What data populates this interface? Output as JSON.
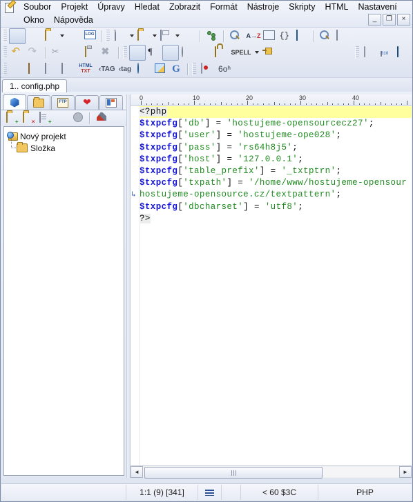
{
  "window": {
    "app_icon": "notepad-pencil-icon",
    "controls": {
      "minimize": "_",
      "restore": "❐",
      "close": "×"
    }
  },
  "menu": {
    "row1": [
      "Soubor",
      "Projekt",
      "Úpravy",
      "Hledat",
      "Zobrazit",
      "Formát",
      "Nástroje",
      "Skripty",
      "HTML",
      "Nastavení"
    ],
    "row2": [
      "Okno",
      "Nápověda"
    ]
  },
  "toolbars": {
    "row1": [
      {
        "name": "project-cube-icon",
        "glyph": "cube",
        "selected": true
      },
      {
        "name": "project-open-icon",
        "glyph": "cube-pages"
      },
      {
        "name": "project-folder-open-icon",
        "glyph": "folder-open"
      },
      {
        "name": "project-dropdown-arrow",
        "glyph": "arrow"
      },
      {
        "name": "project-save-icon",
        "glyph": "gray-blob"
      },
      {
        "name": "log-icon",
        "glyph": "log"
      },
      {
        "name": "new-file-icon",
        "glyph": "page"
      },
      {
        "name": "new-file-dropdown-arrow",
        "glyph": "arrow"
      },
      {
        "name": "open-file-icon",
        "glyph": "folder-open"
      },
      {
        "name": "open-file-dropdown-arrow",
        "glyph": "arrow"
      },
      {
        "name": "save-file-icon",
        "glyph": "disk"
      },
      {
        "name": "save-dropdown-arrow",
        "glyph": "arrow"
      },
      {
        "name": "close-file-icon",
        "glyph": "gray-blob"
      },
      {
        "name": "code-explorer-icon",
        "glyph": "tree-dots"
      },
      {
        "name": "find-icon",
        "glyph": "magnifier"
      },
      {
        "name": "replace-icon",
        "glyph": "a-to-z"
      },
      {
        "name": "find-in-files-icon",
        "glyph": "magnifier-screen"
      },
      {
        "name": "goto-icon",
        "glyph": "braces"
      },
      {
        "name": "dictionary-icon",
        "glyph": "book"
      },
      {
        "name": "print-preview-icon",
        "glyph": "preview"
      },
      {
        "name": "print-icon",
        "glyph": "printer"
      }
    ],
    "row2": [
      {
        "name": "undo-icon",
        "glyph": "undo"
      },
      {
        "name": "redo-icon",
        "glyph": "redo"
      },
      {
        "name": "cut-icon",
        "glyph": "scissors"
      },
      {
        "name": "copy-icon",
        "glyph": "copy"
      },
      {
        "name": "paste-icon",
        "glyph": "clipboard"
      },
      {
        "name": "delete-icon",
        "glyph": "x"
      },
      {
        "name": "format-text-icon",
        "glyph": "lines-blue",
        "selected": true
      },
      {
        "name": "pilcrow-icon",
        "glyph": "pilcrow"
      },
      {
        "name": "highlighter-icon",
        "glyph": "lines-red",
        "selected": true
      },
      {
        "name": "color-palette-icon",
        "glyph": "palette"
      },
      {
        "name": "numbered-list-icon",
        "glyph": "list"
      },
      {
        "name": "lock-icon",
        "glyph": "lock"
      },
      {
        "name": "spell-check-label",
        "glyph": "spell",
        "label": "SPELL"
      },
      {
        "name": "spell-dropdown-arrow",
        "glyph": "arrow"
      },
      {
        "name": "bookmark-pin-icon",
        "glyph": "pin"
      },
      {
        "name": "panel-toggle-icon",
        "glyph": "gray-square"
      },
      {
        "name": "hex-editor-icon",
        "glyph": "doc010"
      },
      {
        "name": "preview-monitor-icon",
        "glyph": "monitor"
      }
    ],
    "row3": [
      {
        "name": "indent-icon",
        "glyph": "indent"
      },
      {
        "name": "package-icon",
        "glyph": "box3d"
      },
      {
        "name": "color-table-icon",
        "glyph": "grid-color"
      },
      {
        "name": "table-10-icon",
        "glyph": "grid-10"
      },
      {
        "name": "html-to-txt-icon",
        "glyph": "html-txt"
      },
      {
        "name": "tag-upper-icon",
        "glyph": "tag",
        "label": "‹TAG"
      },
      {
        "name": "tag-lower-icon",
        "glyph": "tag",
        "label": "‹tag"
      },
      {
        "name": "browser-preview-icon",
        "glyph": "globe"
      },
      {
        "name": "flag-icon",
        "glyph": "flag"
      },
      {
        "name": "google-icon",
        "glyph": "g",
        "label": "G"
      },
      {
        "name": "record-macro-icon",
        "glyph": "record"
      },
      {
        "name": "spectacles-icon",
        "glyph": "glasses",
        "label": "6oʰ"
      }
    ]
  },
  "tabs": {
    "file_tab": "1.. config.php"
  },
  "sidebar": {
    "tabs": [
      {
        "name": "sidebar-tab-project",
        "icon": "cube-icon",
        "active": true
      },
      {
        "name": "sidebar-tab-files",
        "icon": "folder-icon",
        "active": false
      },
      {
        "name": "sidebar-tab-ftp",
        "icon": "ftp-icon",
        "active": false
      },
      {
        "name": "sidebar-tab-favorites",
        "icon": "heart-icon",
        "active": false
      },
      {
        "name": "sidebar-tab-windows",
        "icon": "windows-icon",
        "active": false
      }
    ],
    "tools": [
      {
        "name": "add-project-icon",
        "glyph": "folder-plus"
      },
      {
        "name": "remove-project-icon",
        "glyph": "folder-x"
      },
      {
        "name": "add-file-icon",
        "glyph": "doc-plus"
      },
      {
        "name": "remove-file-icon",
        "glyph": "doc-gray"
      },
      {
        "name": "project-options-icon",
        "glyph": "circle-gray"
      },
      {
        "name": "project-settings-icon",
        "glyph": "tools"
      }
    ],
    "tree": [
      {
        "label": "Nový projekt",
        "level": 0,
        "icon": "project-icon"
      },
      {
        "label": "Složka",
        "level": 1,
        "icon": "folder-icon"
      }
    ]
  },
  "editor": {
    "ruler_numbers": [
      "0",
      "10",
      "20",
      "30",
      "40"
    ],
    "wrap_marker": "↳",
    "lines": [
      {
        "highlight": true,
        "tokens": [
          {
            "t": "<?php",
            "c": "php"
          }
        ]
      },
      {
        "highlight": false,
        "tokens": [
          {
            "t": "$txpcfg",
            "c": "var"
          },
          {
            "t": "[",
            "c": "pun"
          },
          {
            "t": "'db'",
            "c": "str"
          },
          {
            "t": "]",
            "c": "pun"
          },
          {
            "t": " = ",
            "c": "pun"
          },
          {
            "t": "'hostujeme-opensourcecz27'",
            "c": "str"
          },
          {
            "t": ";",
            "c": "pun"
          }
        ]
      },
      {
        "highlight": false,
        "tokens": [
          {
            "t": "$txpcfg",
            "c": "var"
          },
          {
            "t": "[",
            "c": "pun"
          },
          {
            "t": "'user'",
            "c": "str"
          },
          {
            "t": "]",
            "c": "pun"
          },
          {
            "t": " = ",
            "c": "pun"
          },
          {
            "t": "'hostujeme-ope028'",
            "c": "str"
          },
          {
            "t": ";",
            "c": "pun"
          }
        ]
      },
      {
        "highlight": false,
        "tokens": [
          {
            "t": "$txpcfg",
            "c": "var"
          },
          {
            "t": "[",
            "c": "pun"
          },
          {
            "t": "'pass'",
            "c": "str"
          },
          {
            "t": "]",
            "c": "pun"
          },
          {
            "t": " = ",
            "c": "pun"
          },
          {
            "t": "'rs64h8j5'",
            "c": "str"
          },
          {
            "t": ";",
            "c": "pun"
          }
        ]
      },
      {
        "highlight": false,
        "tokens": [
          {
            "t": "$txpcfg",
            "c": "var"
          },
          {
            "t": "[",
            "c": "pun"
          },
          {
            "t": "'host'",
            "c": "str"
          },
          {
            "t": "]",
            "c": "pun"
          },
          {
            "t": " = ",
            "c": "pun"
          },
          {
            "t": "'127.0.0.1'",
            "c": "str"
          },
          {
            "t": ";",
            "c": "pun"
          }
        ]
      },
      {
        "highlight": false,
        "tokens": [
          {
            "t": "$txpcfg",
            "c": "var"
          },
          {
            "t": "[",
            "c": "pun"
          },
          {
            "t": "'table_prefix'",
            "c": "str"
          },
          {
            "t": "]",
            "c": "pun"
          },
          {
            "t": " = ",
            "c": "pun"
          },
          {
            "t": "'_txtptrn'",
            "c": "str"
          },
          {
            "t": ";",
            "c": "pun"
          }
        ]
      },
      {
        "highlight": false,
        "tokens": [
          {
            "t": "$txpcfg",
            "c": "var"
          },
          {
            "t": "[",
            "c": "pun"
          },
          {
            "t": "'txpath'",
            "c": "str"
          },
          {
            "t": "]",
            "c": "pun"
          },
          {
            "t": " = ",
            "c": "pun"
          },
          {
            "t": "'/home/www/hostujeme-opensour",
            "c": "str"
          }
        ]
      },
      {
        "highlight": false,
        "wrapped": true,
        "tokens": [
          {
            "t": "hostujeme-opensource.cz/textpattern'",
            "c": "str"
          },
          {
            "t": ";",
            "c": "pun"
          }
        ]
      },
      {
        "highlight": false,
        "tokens": [
          {
            "t": "$txpcfg",
            "c": "var"
          },
          {
            "t": "[",
            "c": "pun"
          },
          {
            "t": "'dbcharset'",
            "c": "str"
          },
          {
            "t": "]",
            "c": "pun"
          },
          {
            "t": " = ",
            "c": "pun"
          },
          {
            "t": "'utf8'",
            "c": "str"
          },
          {
            "t": ";",
            "c": "pun"
          }
        ]
      },
      {
        "highlight": false,
        "tokens": [
          {
            "t": "?>",
            "c": "php"
          }
        ]
      }
    ],
    "hscroll": {
      "left_arrow": "◄",
      "right_arrow": "►"
    }
  },
  "status": {
    "caret": "1:1  (9)  [341]",
    "wrap_icon": "lines-icon",
    "char_info": "<  60 $3C",
    "language": "PHP"
  },
  "colors": {
    "highlight_line": "#ffff9e",
    "variable": "#1414d6",
    "string": "#1f8a1f",
    "punctuation": "#101010",
    "chrome": "#dfe5f1"
  }
}
